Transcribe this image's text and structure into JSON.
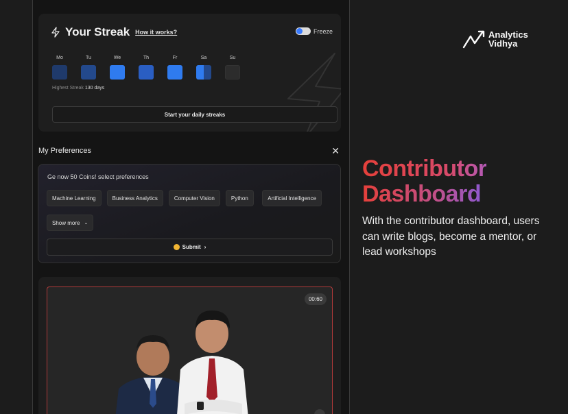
{
  "streak": {
    "title": "Your Streak",
    "how_link": "How it works?",
    "freeze_label": "Freeze",
    "days": [
      {
        "label": "Mo",
        "color": "#1f3a6b"
      },
      {
        "label": "Tu",
        "color": "#23498c"
      },
      {
        "label": "We",
        "color": "#2f7bef"
      },
      {
        "label": "Th",
        "color": "#2a5ec2"
      },
      {
        "label": "Fr",
        "color": "#2f7bef"
      },
      {
        "label": "Sa",
        "color": "#2f7bef"
      },
      {
        "label": "Su",
        "color": "#2c2c2c"
      }
    ],
    "highest_label": "Highest Streak",
    "highest_value": "130 days",
    "start_button": "Start your daily streaks"
  },
  "preferences": {
    "header": "My Preferences",
    "close_glyph": "✕",
    "prompt": "Ge now 50 Coins! select preferences",
    "chips": [
      "Machine Learning",
      "Business Analytics",
      "Computer Vision",
      "Python",
      "Artificial Intelligence"
    ],
    "show_more": "Show more",
    "submit": "Submit"
  },
  "video": {
    "timer": "00:60"
  },
  "brand": {
    "line1": "Analytics",
    "line2": "Vidhya"
  },
  "promo": {
    "headline_1": "Contributor",
    "headline_2": "Dashboard",
    "description": "With the contributor dashboard, users can write blogs, become a mentor, or lead workshops"
  },
  "icons": {
    "bolt": "bolt-icon",
    "close": "close-icon",
    "coin": "coin-icon",
    "chevron": "chevron-right-icon",
    "share": "share-icon",
    "logo": "analytics-vidhya-logo"
  }
}
